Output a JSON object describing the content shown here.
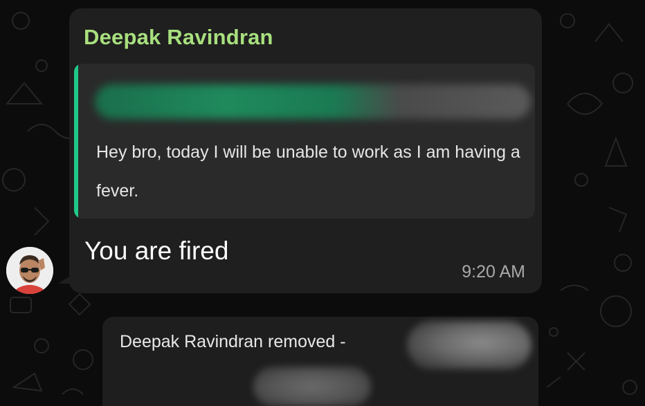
{
  "message": {
    "sender_name": "Deepak Ravindran",
    "quoted_text": "Hey bro, today I will be unable to work as I am having a fever.",
    "text": "You are fired",
    "time": "9:20 AM"
  },
  "system_message": {
    "text": "Deepak Ravindran removed -"
  },
  "colors": {
    "background": "#0c0c0c",
    "bubble": "#1f1f1f",
    "quote_background": "#2a2a2a",
    "quote_bar": "#1fc98a",
    "sender_name": "#a8e07e",
    "timestamp": "#a9a9a9"
  },
  "icons": {
    "avatar": "profile-photo"
  }
}
